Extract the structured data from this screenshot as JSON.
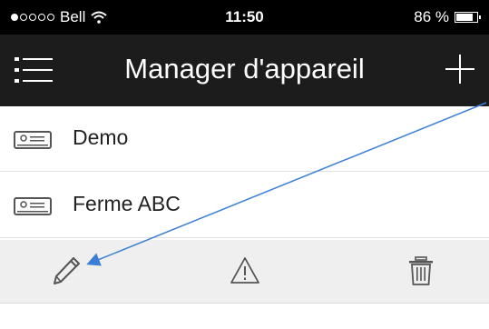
{
  "status_bar": {
    "carrier": "Bell",
    "time": "11:50",
    "battery": "86 %",
    "battery_level": 0.86
  },
  "nav": {
    "title": "Manager d'appareil",
    "menu_icon": "hamburger-icon",
    "add_icon": "plus-icon"
  },
  "devices": [
    {
      "label": "Demo",
      "icon": "device-icon"
    },
    {
      "label": "Ferme ABC",
      "icon": "device-icon"
    }
  ],
  "actions": {
    "edit_icon": "pencil-icon",
    "warning_icon": "warning-icon",
    "delete_icon": "trash-icon"
  },
  "colors": {
    "navbar": "#1c1c1c",
    "annotation_arrow": "#3a7fd5",
    "action_bar": "#efefef"
  }
}
